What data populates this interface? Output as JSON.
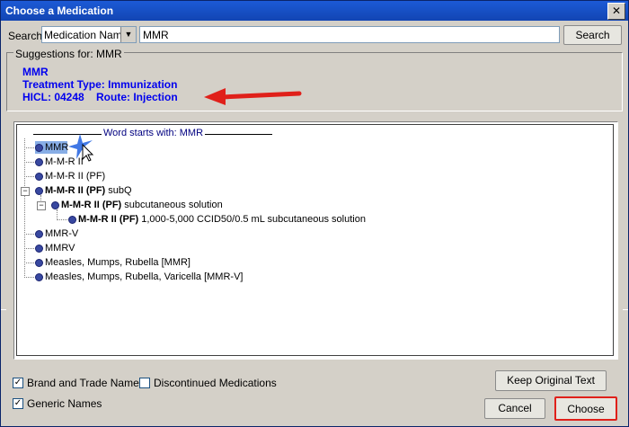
{
  "window": {
    "title": "Choose a Medication",
    "close_glyph": "✕"
  },
  "search": {
    "label": "Search",
    "type_selected": "Medication Name",
    "query": "MMR",
    "button_label": "Search"
  },
  "suggestions": {
    "label": "Suggestions for: MMR",
    "name": "MMR",
    "treatment_type": "Treatment Type: Immunization",
    "hicl": "HICL: 04248",
    "route": "Route: Injection",
    "accent_color": "#0000ee",
    "annotation_arrow_color": "#e0201a"
  },
  "tree": {
    "group_label": "Word starts with: MMR",
    "items": [
      {
        "label": "MMR",
        "selected": true
      },
      {
        "label": "M-M-R II"
      },
      {
        "label": "M-M-R II (PF)"
      },
      {
        "label_bold": "M-M-R II (PF)",
        "label_rest": " subQ",
        "expanded": true
      },
      {
        "label_bold": "M-M-R II (PF)",
        "label_rest": " subcutaneous solution",
        "expanded": true
      },
      {
        "label_bold": "M-M-R II (PF)",
        "label_rest": " 1,000-5,000 CCID50/0.5 mL subcutaneous solution"
      },
      {
        "label": "MMR-V"
      },
      {
        "label": "MMRV"
      },
      {
        "label": "Measles, Mumps, Rubella [MMR]"
      },
      {
        "label": "Measles, Mumps, Rubella, Varicella [MMR-V]"
      }
    ]
  },
  "options": {
    "brand_trade": {
      "label": "Brand and Trade Names",
      "checked": true
    },
    "discontinued": {
      "label": "Discontinued Medications",
      "checked": false
    },
    "generic": {
      "label": "Generic Names",
      "checked": true
    }
  },
  "buttons": {
    "keep_original": "Keep Original Text",
    "cancel": "Cancel",
    "choose": "Choose"
  }
}
